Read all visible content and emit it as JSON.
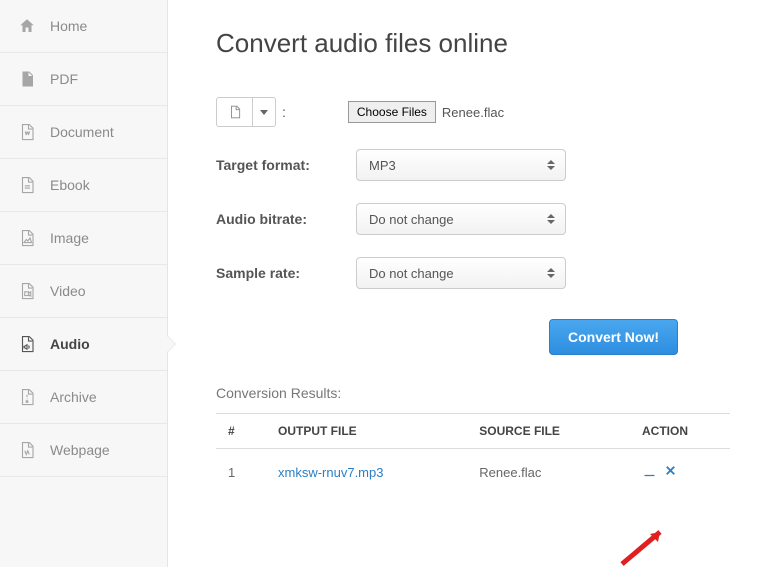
{
  "sidebar": {
    "items": [
      {
        "label": "Home"
      },
      {
        "label": "PDF"
      },
      {
        "label": "Document"
      },
      {
        "label": "Ebook"
      },
      {
        "label": "Image"
      },
      {
        "label": "Video"
      },
      {
        "label": "Audio"
      },
      {
        "label": "Archive"
      },
      {
        "label": "Webpage"
      }
    ]
  },
  "page": {
    "title": "Convert audio files online"
  },
  "form": {
    "choose_files_label": "Choose Files",
    "selected_file": "Renee.flac",
    "target_format_label": "Target format:",
    "target_format_value": "MP3",
    "audio_bitrate_label": "Audio bitrate:",
    "audio_bitrate_value": "Do not change",
    "sample_rate_label": "Sample rate:",
    "sample_rate_value": "Do not change",
    "convert_label": "Convert Now!"
  },
  "results": {
    "title": "Conversion Results:",
    "cols": {
      "idx": "#",
      "output": "OUTPUT FILE",
      "source": "SOURCE FILE",
      "action": "ACTION"
    },
    "rows": [
      {
        "idx": "1",
        "output": "xmksw-rnuv7.mp3",
        "source": "Renee.flac"
      }
    ]
  }
}
